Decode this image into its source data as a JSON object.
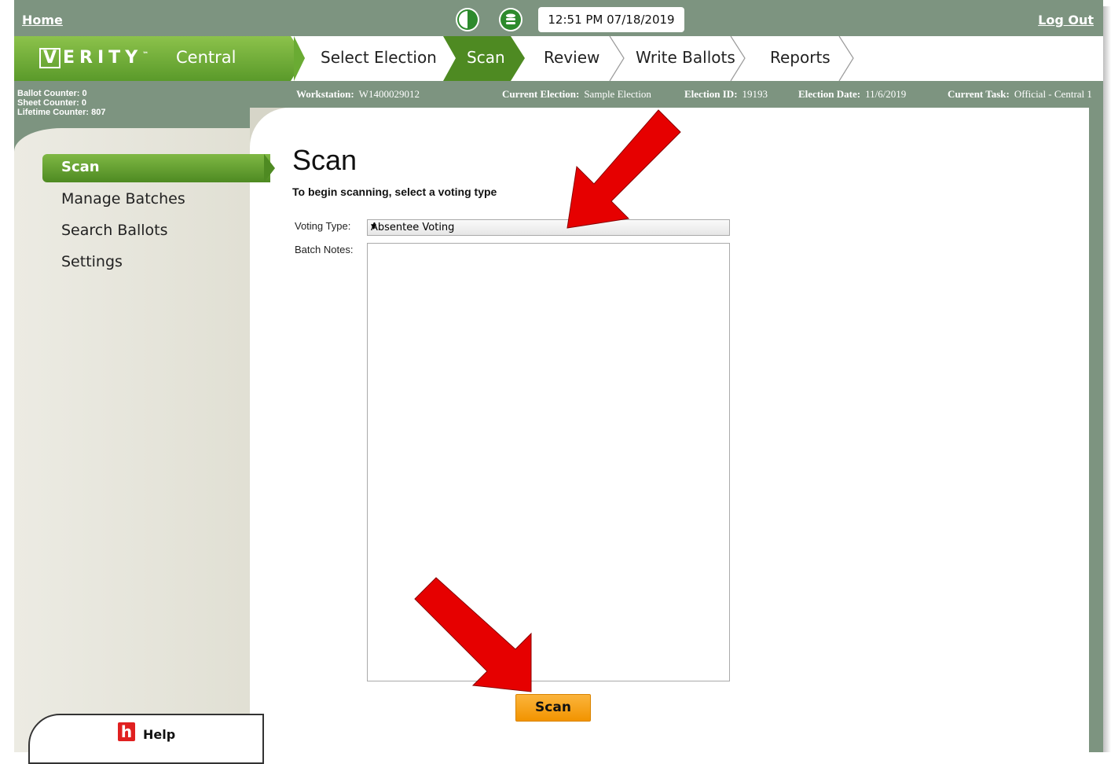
{
  "topbar": {
    "home": "Home",
    "logout": "Log Out",
    "clock": "12:51 PM 07/18/2019",
    "icons": [
      "status-pie-icon",
      "database-icon"
    ]
  },
  "brand": {
    "logo_box": "V",
    "logo_rest": "ERITY",
    "tm": "™",
    "product": "Central",
    "color": "#6aab33"
  },
  "nav": {
    "steps": [
      "Select Election",
      "Scan",
      "Review",
      "Write Ballots",
      "Reports"
    ],
    "active": "Scan"
  },
  "info": {
    "ballot_counter": "Ballot Counter: 0",
    "sheet_counter": "Sheet Counter: 0",
    "lifetime_counter": "Lifetime Counter: 807",
    "workstation_label": "Workstation:",
    "workstation_value": "W1400029012",
    "election_label": "Current Election:",
    "election_value": "Sample Election",
    "election_id_label": "Election ID:",
    "election_id_value": "19193",
    "election_date_label": "Election Date:",
    "election_date_value": "11/6/2019",
    "task_label": "Current Task:",
    "task_value": "Official - Central 1"
  },
  "sidebar": {
    "items": [
      "Scan",
      "Manage Batches",
      "Search Ballots",
      "Settings"
    ],
    "active": "Scan",
    "help": "Help"
  },
  "main": {
    "title": "Scan",
    "subtitle": "To begin scanning, select a voting type",
    "voting_type_label": "Voting Type:",
    "voting_type_value": "Absentee Voting",
    "batch_notes_label": "Batch Notes:",
    "scan_button": "Scan"
  },
  "colors": {
    "header_bg": "#7d9480",
    "accent_green": "#5a9a2a",
    "scan_button": "#f5a01a",
    "annotation_arrow": "#e60000"
  }
}
